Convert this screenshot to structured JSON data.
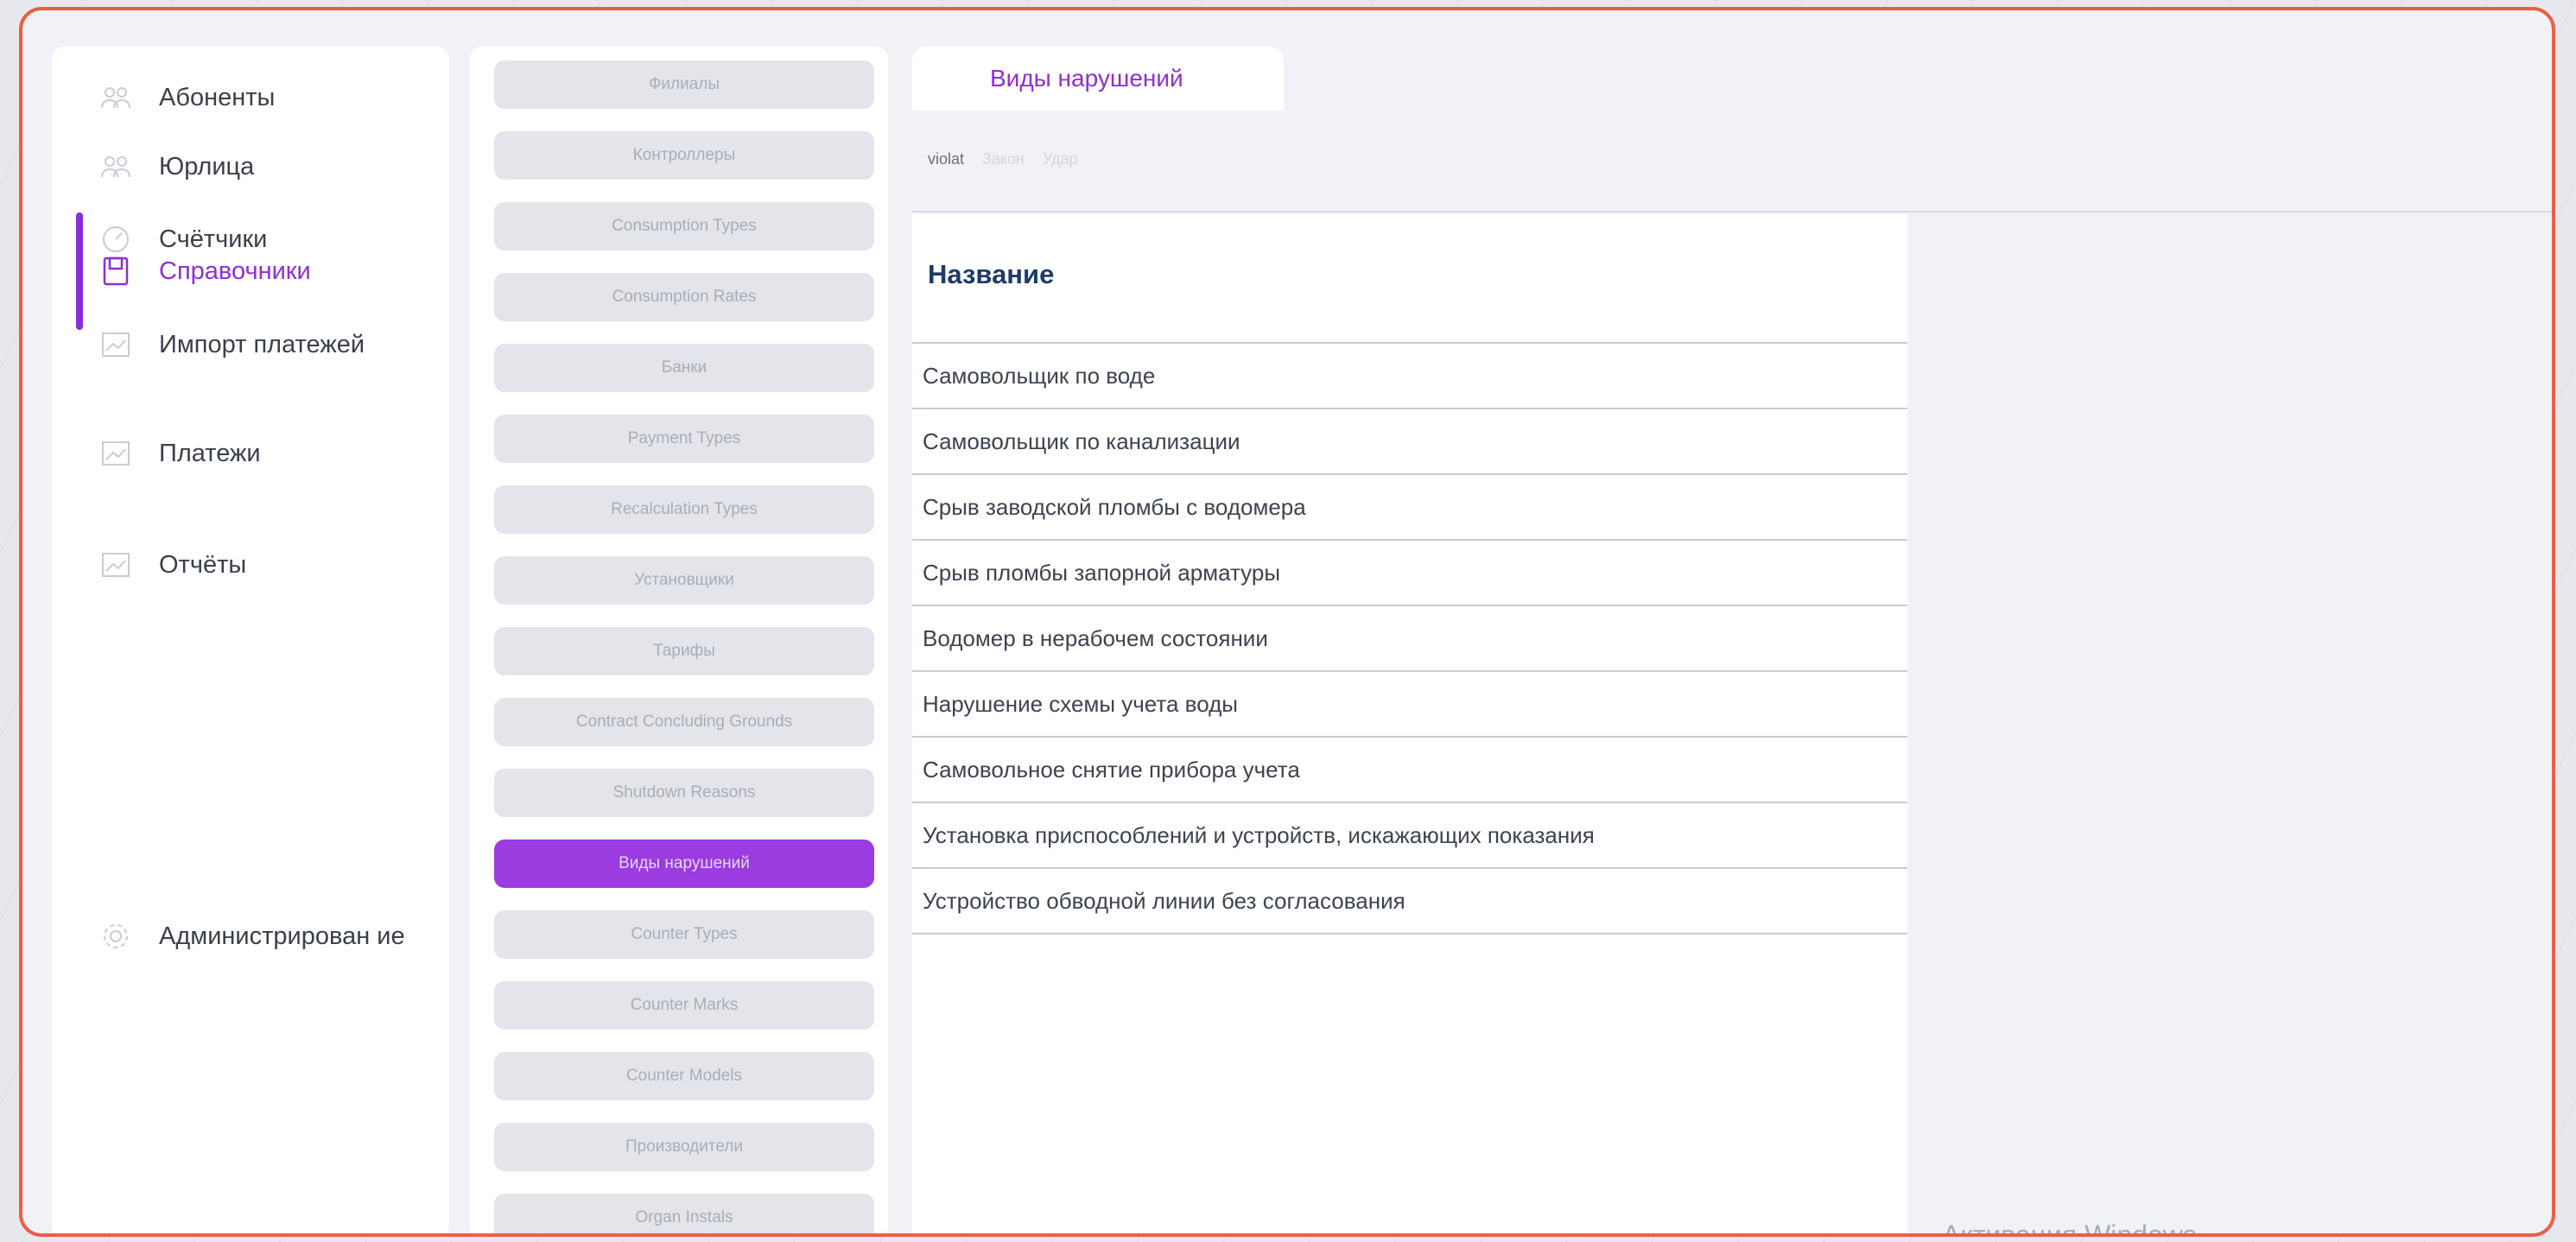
{
  "sidebar": {
    "items": [
      {
        "label": "Абоненты",
        "icon": "users-icon"
      },
      {
        "label": "Юрлица",
        "icon": "users-icon"
      },
      {
        "label": "Счётчики",
        "icon": "gauge-icon"
      },
      {
        "label": "Справочники",
        "icon": "book-icon",
        "active": true
      },
      {
        "label": "Импорт платежей",
        "icon": "chart-icon"
      },
      {
        "label": "Платежи",
        "icon": "chart-icon"
      },
      {
        "label": "Отчёты",
        "icon": "chart-icon"
      },
      {
        "label": "Администрирован ие",
        "icon": "gear-icon"
      }
    ]
  },
  "references": {
    "items": [
      "Филиалы",
      "Контроллеры",
      "Consumption Types",
      "Consumption Rates",
      "Банки",
      "Payment Types",
      "Recalculation Types",
      "Установщики",
      "Тарифы",
      "Contract Concluding Grounds",
      "Shutdown Reasons",
      "Виды нарушений",
      "Counter Types",
      "Counter Marks",
      "Counter Models",
      "Производители",
      "Organ Instals"
    ],
    "active": "Виды нарушений"
  },
  "content": {
    "tab_label": "Виды нарушений",
    "languages": [
      "violat",
      "Закон",
      "Удар"
    ],
    "table": {
      "header": "Название",
      "rows": [
        "Самовольщик по воде",
        "Самовольщик по канализации",
        "Срыв заводской пломбы с водомера",
        "Срыв пломбы запорной арматуры",
        "Водомер в нерабочем состоянии",
        "Нарушение схемы учета воды",
        "Самовольное снятие прибора учета",
        "Установка приспособлений и устройств, искажающих показания",
        "Устройство обводной линии без согласования"
      ]
    }
  },
  "os_watermark": "Активация Windows",
  "colors": {
    "accent": "#8e2fd6",
    "frame_border": "#ef5d45",
    "header_text": "#1e3a6b"
  }
}
